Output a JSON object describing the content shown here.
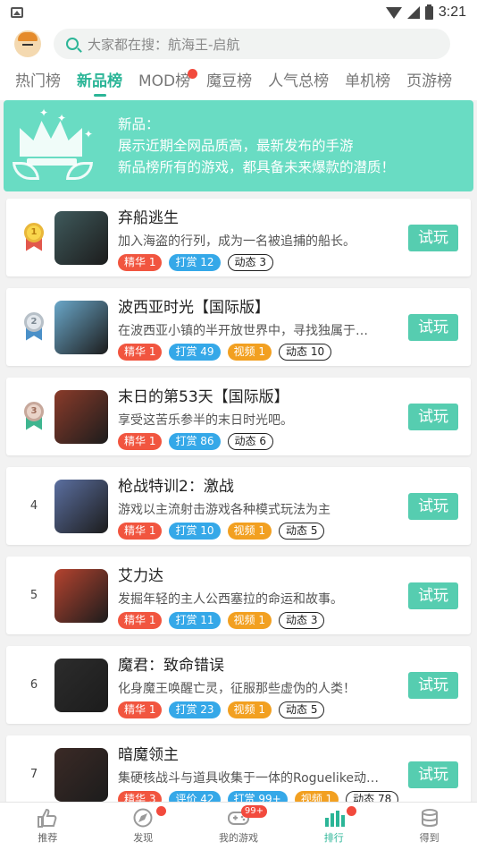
{
  "status": {
    "time": "3:21"
  },
  "search": {
    "placeholder": "大家都在搜：航海王-启航"
  },
  "tabs": [
    "热门榜",
    "新品榜",
    "MOD榜",
    "魔豆榜",
    "人气总榜",
    "单机榜",
    "页游榜"
  ],
  "active_tab": "新品榜",
  "banner": {
    "heading": "新品：",
    "line1": "展示近期全网品质高，最新发布的手游",
    "line2": "新品榜所有的游戏，都具备未来爆款的潜质！"
  },
  "play_label": "试玩",
  "games": [
    {
      "rank": "1",
      "title": "弃船逃生",
      "desc": "加入海盗的行列，成为一名被追捕的船长。",
      "tags": [
        {
          "text": "精华 1",
          "kind": "red"
        },
        {
          "text": "打赏 12",
          "kind": "blue"
        },
        {
          "text": "动态 3",
          "kind": "outline"
        }
      ]
    },
    {
      "rank": "2",
      "title": "波西亚时光【国际版】",
      "desc": "在波西亚小镇的半开放世界中，寻找独属于…",
      "tags": [
        {
          "text": "精华 1",
          "kind": "red"
        },
        {
          "text": "打赏 49",
          "kind": "blue"
        },
        {
          "text": "视频 1",
          "kind": "orange"
        },
        {
          "text": "动态 10",
          "kind": "outline"
        }
      ]
    },
    {
      "rank": "3",
      "title": "末日的第53天【国际版】",
      "desc": "享受这苦乐参半的末日时光吧。",
      "tags": [
        {
          "text": "精华 1",
          "kind": "red"
        },
        {
          "text": "打赏 86",
          "kind": "blue"
        },
        {
          "text": "动态 6",
          "kind": "outline"
        }
      ]
    },
    {
      "rank": "4",
      "title": "枪战特训2：激战",
      "desc": "游戏以主流射击游戏各种模式玩法为主",
      "tags": [
        {
          "text": "精华 1",
          "kind": "red"
        },
        {
          "text": "打赏 10",
          "kind": "blue"
        },
        {
          "text": "视频 1",
          "kind": "orange"
        },
        {
          "text": "动态 5",
          "kind": "outline"
        }
      ]
    },
    {
      "rank": "5",
      "title": "艾力达",
      "desc": "发掘年轻的主人公西塞拉的命运和故事。",
      "tags": [
        {
          "text": "精华 1",
          "kind": "red"
        },
        {
          "text": "打赏 11",
          "kind": "blue"
        },
        {
          "text": "视频 1",
          "kind": "orange"
        },
        {
          "text": "动态 3",
          "kind": "outline"
        }
      ]
    },
    {
      "rank": "6",
      "title": "魔君：致命错误",
      "desc": "化身魔王唤醒亡灵，征服那些虚伪的人类！",
      "tags": [
        {
          "text": "精华 1",
          "kind": "red"
        },
        {
          "text": "打赏 23",
          "kind": "blue"
        },
        {
          "text": "视频 1",
          "kind": "orange"
        },
        {
          "text": "动态 5",
          "kind": "outline"
        }
      ]
    },
    {
      "rank": "7",
      "title": "暗魔领主",
      "desc": "集硬核战斗与道具收集于一体的Roguelike动…",
      "tags": [
        {
          "text": "精华 3",
          "kind": "red"
        },
        {
          "text": "评价 42",
          "kind": "blue"
        },
        {
          "text": "打赏 99+",
          "kind": "blue"
        },
        {
          "text": "视频 1",
          "kind": "orange"
        },
        {
          "text": "动态 78",
          "kind": "outline"
        }
      ]
    }
  ],
  "thumb_colors": [
    "#3f5a5c",
    "#6aa7c9",
    "#8a3b2a",
    "#5b6fa0",
    "#b5432f",
    "#2c2c2c",
    "#3b2a26"
  ],
  "bottom_nav": [
    {
      "label": "推荐",
      "icon": "thumbs-up-icon"
    },
    {
      "label": "发现",
      "icon": "compass-icon",
      "dot": true
    },
    {
      "label": "我的游戏",
      "icon": "gamepad-icon",
      "badge": "99+"
    },
    {
      "label": "排行",
      "icon": "bar-chart-icon",
      "dot": true,
      "active": true
    },
    {
      "label": "得到",
      "icon": "coins-icon"
    }
  ]
}
